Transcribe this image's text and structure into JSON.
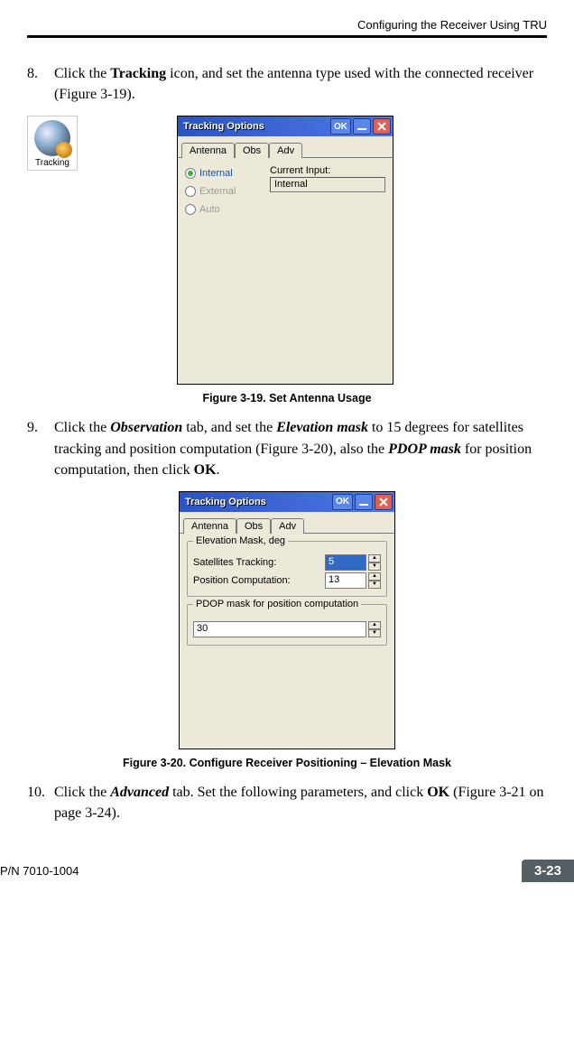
{
  "header": {
    "running_head": "Configuring the Receiver Using TRU"
  },
  "steps": {
    "s8": {
      "num": "8.",
      "text_pre": "Click the ",
      "bold1": "Tracking",
      "text_post": " icon, and set the antenna type used with the connected receiver (Figure 3-19)."
    },
    "s9": {
      "num": "9.",
      "p1": "Click the ",
      "bi1": "Observation",
      "p2": " tab, and set the ",
      "bi2": "Elevation mask",
      "p3": " to 15 degrees for satellites tracking and position computation (Figure 3-20), also the ",
      "bi3": "PDOP mask",
      "p4": " for position computation, then click ",
      "b1": "OK",
      "p5": "."
    },
    "s10": {
      "num": "10.",
      "p1": "Click the ",
      "bi1": "Advanced",
      "p2": " tab. Set the following parameters, and click ",
      "b1": "OK",
      "p3": " (Figure 3-21 on page 3-24)."
    }
  },
  "tracking_icon_label": "Tracking",
  "dialog1": {
    "title": "Tracking Options",
    "ok": "OK",
    "tabs": {
      "antenna": "Antenna",
      "obs": "Obs",
      "adv": "Adv"
    },
    "radios": {
      "internal": "Internal",
      "external": "External",
      "auto": "Auto"
    },
    "current_label": "Current Input:",
    "current_value": "Internal"
  },
  "caption1": "Figure 3-19. Set Antenna Usage",
  "dialog2": {
    "title": "Tracking Options",
    "ok": "OK",
    "tabs": {
      "antenna": "Antenna",
      "obs": "Obs",
      "adv": "Adv"
    },
    "group1": {
      "legend": "Elevation Mask, deg",
      "sat_label": "Satellites Tracking:",
      "sat_value": "5",
      "pos_label": "Position Computation:",
      "pos_value": "13"
    },
    "group2": {
      "legend": "PDOP mask for position computation",
      "value": "30"
    }
  },
  "caption2": "Figure 3-20. Configure Receiver Positioning – Elevation Mask",
  "footer": {
    "pn": "P/N 7010-1004",
    "page": "3-23"
  }
}
